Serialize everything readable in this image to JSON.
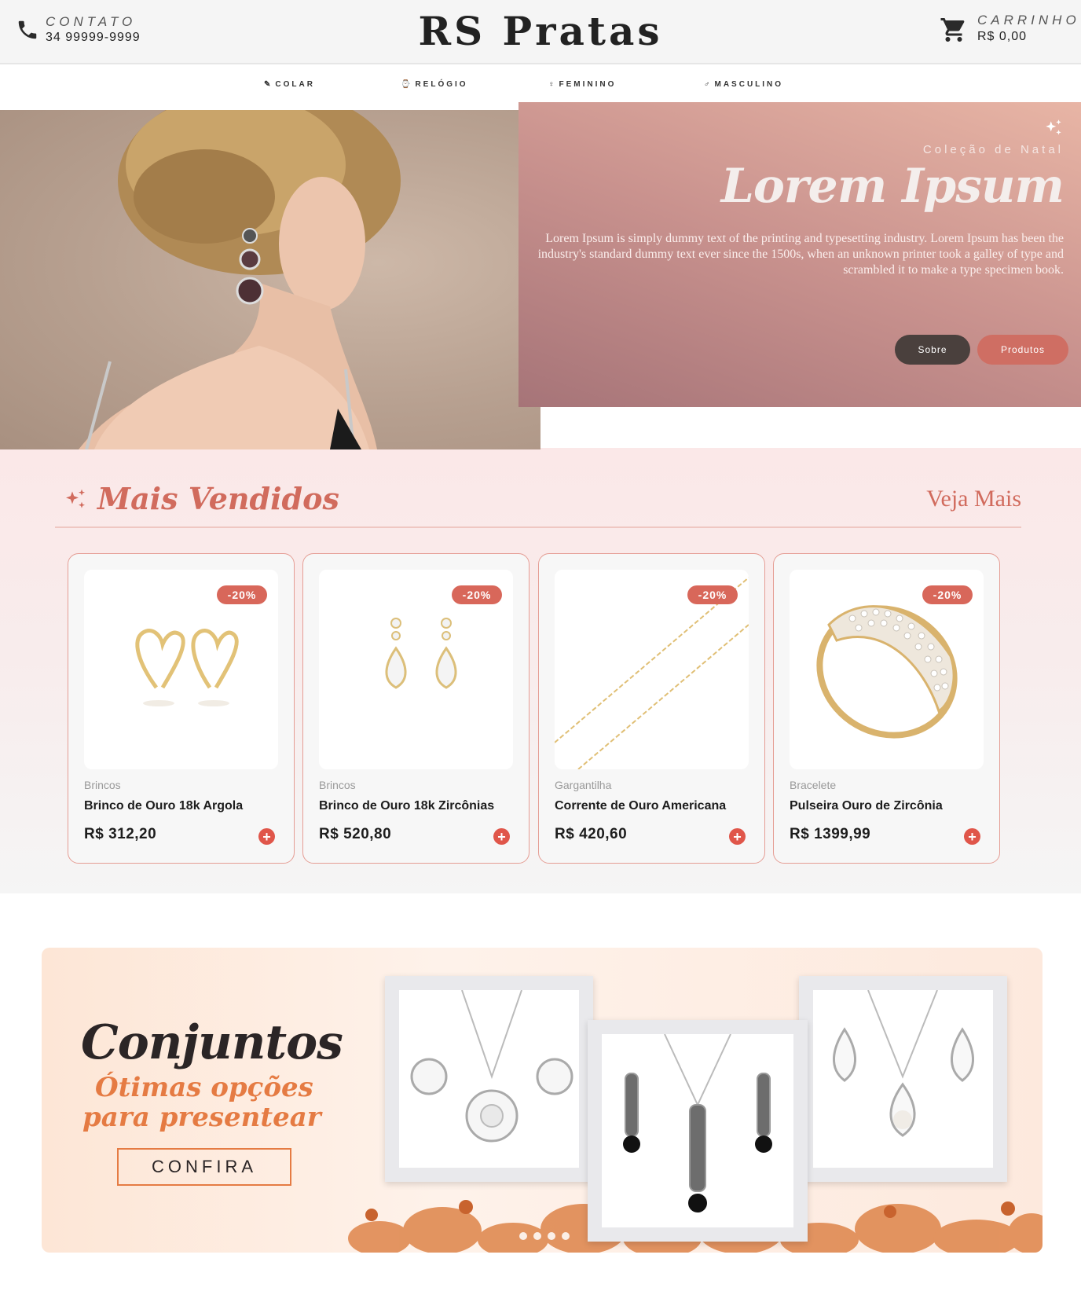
{
  "header": {
    "contact_label": "CONTATO",
    "contact_phone": "34 99999-9999",
    "brand": "RS Pratas",
    "cart_label": "CARRINHO",
    "cart_total": "R$ 0,00"
  },
  "nav": {
    "items": [
      {
        "label": "COLAR",
        "icon": "pen-icon"
      },
      {
        "label": "RELÓGIO",
        "icon": "watch-icon"
      },
      {
        "label": "FEMININO",
        "icon": "female-icon"
      },
      {
        "label": "MASCULINO",
        "icon": "male-icon"
      }
    ]
  },
  "hero": {
    "subtitle": "Coleção de Natal",
    "title": "Lorem Ipsum",
    "text": "Lorem Ipsum is simply dummy text of the printing and typesetting industry. Lorem Ipsum has been the industry's standard dummy text ever since the 1500s, when an unknown printer took a galley of type and scrambled it to make a type specimen book.",
    "button_about": "Sobre",
    "button_products": "Produtos"
  },
  "best_sellers": {
    "title": "Mais Vendidos",
    "see_more": "Veja Mais",
    "products": [
      {
        "badge": "-20%",
        "category": "Brincos",
        "name": "Brinco de Ouro 18k Argola",
        "price": "R$ 312,20"
      },
      {
        "badge": "-20%",
        "category": "Brincos",
        "name": "Brinco de Ouro 18k Zircônias",
        "price": "R$ 520,80"
      },
      {
        "badge": "-20%",
        "category": "Gargantilha",
        "name": "Corrente de Ouro Americana",
        "price": "R$ 420,60"
      },
      {
        "badge": "-20%",
        "category": "Bracelete",
        "name": "Pulseira Ouro de Zircônia",
        "price": "R$ 1399,99"
      }
    ],
    "add_symbol": "+"
  },
  "banner": {
    "title": "Conjuntos",
    "subtitle_line1": "Ótimas opções",
    "subtitle_line2": "para presentear",
    "button": "CONFIRA"
  },
  "colors": {
    "accent": "#d16b5d",
    "badge": "#d8675a",
    "dark_button": "#4a403d",
    "banner_orange": "#e57b43"
  }
}
